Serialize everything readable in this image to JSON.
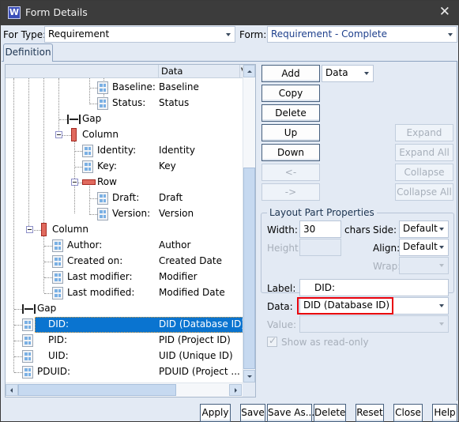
{
  "window": {
    "title": "Form Details",
    "app_icon_letter": "W",
    "close_glyph": "✕"
  },
  "top": {
    "for_type_label": "For Type:",
    "for_type_value": "Requirement",
    "form_label": "Form:",
    "form_value": "Requirement - Complete"
  },
  "tabs": [
    {
      "label": "Definition",
      "active": true
    }
  ],
  "tree": {
    "columns": [
      "",
      "Data",
      "V"
    ],
    "rows": [
      {
        "type": "field",
        "name": "Baseline:",
        "data": "Baseline"
      },
      {
        "type": "field",
        "name": "Status:",
        "data": "Status"
      },
      {
        "type": "gap",
        "name": "Gap",
        "data": ""
      },
      {
        "type": "column",
        "name": "Column",
        "data": "",
        "expanded": true
      },
      {
        "type": "field",
        "name": "Identity:",
        "data": "Identity"
      },
      {
        "type": "field",
        "name": "Key:",
        "data": "Key"
      },
      {
        "type": "row",
        "name": "Row",
        "data": "",
        "expanded": true
      },
      {
        "type": "field",
        "name": "Draft:",
        "data": "Draft"
      },
      {
        "type": "field",
        "name": "Version:",
        "data": "Version"
      },
      {
        "type": "column",
        "name": "Column",
        "data": "",
        "expanded": true
      },
      {
        "type": "field",
        "name": "Author:",
        "data": "Author"
      },
      {
        "type": "field",
        "name": "Created on:",
        "data": "Created Date"
      },
      {
        "type": "field",
        "name": "Last modifier:",
        "data": "Modifier"
      },
      {
        "type": "field",
        "name": "Last modified:",
        "data": "Modified Date"
      },
      {
        "type": "gap",
        "name": "Gap",
        "data": ""
      },
      {
        "type": "field",
        "name": "DID:",
        "data": "DID (Database ID)",
        "selected": true
      },
      {
        "type": "field",
        "name": "PID:",
        "data": "PID (Project ID)"
      },
      {
        "type": "field",
        "name": "UID:",
        "data": "UID (Unique ID)"
      },
      {
        "type": "field",
        "name": "PDUID:",
        "data": "PDUID (Project ..."
      }
    ]
  },
  "actions": {
    "add": "Add",
    "add_type": "Data",
    "copy": "Copy",
    "delete": "Delete",
    "up": "Up",
    "down": "Down",
    "left": "<-",
    "right": "->",
    "expand": "Expand",
    "expand_all": "Expand All",
    "collapse": "Collapse",
    "collapse_all": "Collapse All"
  },
  "layout_props": {
    "title": "Layout Part Properties",
    "width_label": "Width:",
    "width_value": "30",
    "width_unit": "chars",
    "height_label": "Height:",
    "side_label": "Side:",
    "side_value": "Default",
    "align_label": "Align:",
    "align_value": "Default",
    "wrap_label": "Wrap:"
  },
  "part": {
    "label_label": "Label:",
    "label_value": "DID:",
    "data_label": "Data:",
    "data_value": "DID (Database ID)",
    "value_label": "Value:",
    "readonly_label": "Show as read-only",
    "readonly_checked": true
  },
  "footer": {
    "apply": "Apply",
    "save": "Save",
    "save_as": "Save As...",
    "delete": "Delete",
    "reset": "Reset",
    "close": "Close",
    "help": "Help"
  },
  "colors": {
    "selection": "#0a74d0",
    "highlight_box": "#e8000b",
    "titlebar": "#3c3c3c",
    "panel_bg": "#e3eaf4"
  }
}
